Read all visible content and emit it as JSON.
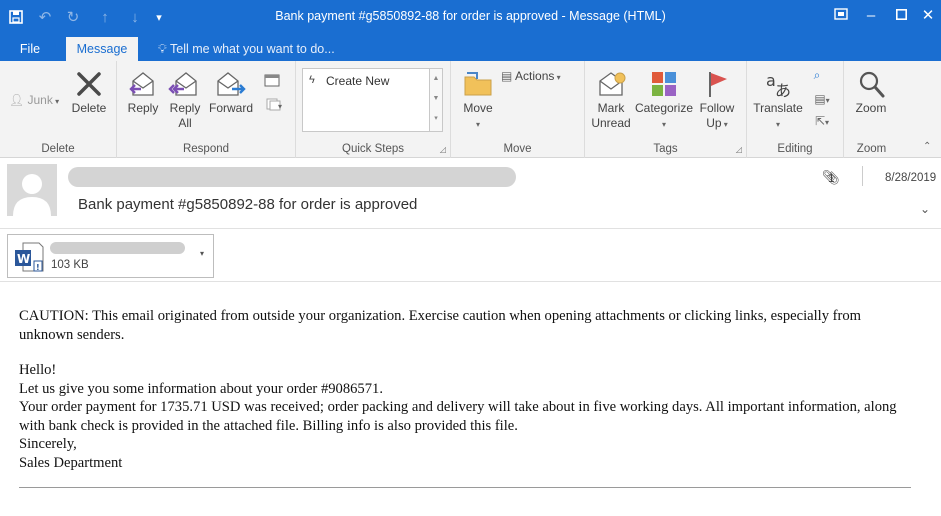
{
  "window": {
    "title": "Bank payment #g5850892-88 for order is approved - Message (HTML)",
    "quick_access": [
      "save-icon",
      "undo-icon",
      "redo-icon",
      "up-arrow-icon",
      "down-arrow-icon",
      "customize-icon"
    ],
    "controls": [
      "restore-down-icon",
      "minimize-icon",
      "maximize-icon",
      "close-icon"
    ]
  },
  "tabs": [
    {
      "label": "File",
      "active": false
    },
    {
      "label": "Message",
      "active": true
    }
  ],
  "tell_me": "Tell me what you want to do...",
  "ribbon": {
    "delete_group": {
      "label": "Delete",
      "junk": "Junk",
      "delete": "Delete"
    },
    "respond_group": {
      "label": "Respond",
      "reply": "Reply",
      "reply_all_line1": "Reply",
      "reply_all_line2": "All",
      "forward": "Forward"
    },
    "quick_steps_group": {
      "label": "Quick Steps",
      "create_new": "Create New"
    },
    "move_group": {
      "label": "Move",
      "move": "Move",
      "actions": "Actions"
    },
    "tags_group": {
      "label": "Tags",
      "mark_unread_line1": "Mark",
      "mark_unread_line2": "Unread",
      "categorize": "Categorize",
      "follow_up_line1": "Follow",
      "follow_up_line2": "Up"
    },
    "editing_group": {
      "label": "Editing",
      "translate": "Translate"
    },
    "zoom_group": {
      "label": "Zoom",
      "zoom": "Zoom"
    }
  },
  "message": {
    "subject": "Bank payment #g5850892-88 for order is approved",
    "attachment_count": "1",
    "date": "8/28/2019",
    "attachment": {
      "size": "103 KB",
      "type_icon": "word-document-icon"
    },
    "body": {
      "caution": "CAUTION: This email originated from outside your organization. Exercise caution when opening attachments or clicking links, especially from unknown senders.",
      "lines": [
        "Hello!",
        "Let us give you some information about your order #9086571.",
        "Your order payment for 1735.71 USD was received; order packing and delivery will take about in five working days. All important information, along with bank check is provided in the attached file. Billing info is also provided this file.",
        "Sincerely,",
        "Sales Department"
      ]
    }
  },
  "colors": {
    "title_bar": "#1a6ed1",
    "ribbon_bg": "#f3f3f3",
    "reply_purple": "#7b4fb3",
    "forward_blue": "#2b7cd3",
    "follow_up_red": "#d9534f"
  }
}
